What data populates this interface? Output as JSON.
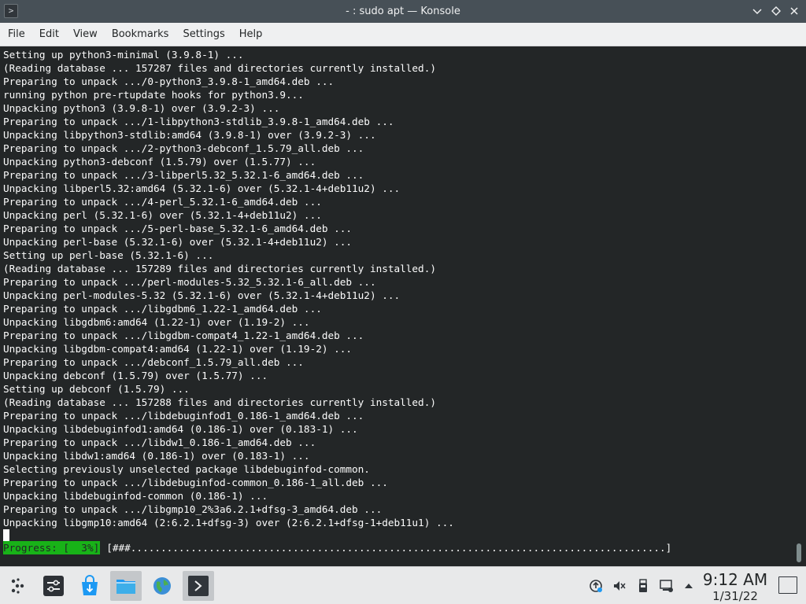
{
  "window": {
    "title": "- : sudo apt — Konsole",
    "app_icon": "terminal-icon"
  },
  "menu": {
    "items": [
      {
        "label": "File"
      },
      {
        "label": "Edit"
      },
      {
        "label": "View"
      },
      {
        "label": "Bookmarks"
      },
      {
        "label": "Settings"
      },
      {
        "label": "Help"
      }
    ]
  },
  "terminal": {
    "lines": [
      "Setting up python3-minimal (3.9.8-1) ...",
      "(Reading database ... 157287 files and directories currently installed.)",
      "Preparing to unpack .../0-python3_3.9.8-1_amd64.deb ...",
      "running python pre-rtupdate hooks for python3.9...",
      "Unpacking python3 (3.9.8-1) over (3.9.2-3) ...",
      "Preparing to unpack .../1-libpython3-stdlib_3.9.8-1_amd64.deb ...",
      "Unpacking libpython3-stdlib:amd64 (3.9.8-1) over (3.9.2-3) ...",
      "Preparing to unpack .../2-python3-debconf_1.5.79_all.deb ...",
      "Unpacking python3-debconf (1.5.79) over (1.5.77) ...",
      "Preparing to unpack .../3-libperl5.32_5.32.1-6_amd64.deb ...",
      "Unpacking libperl5.32:amd64 (5.32.1-6) over (5.32.1-4+deb11u2) ...",
      "Preparing to unpack .../4-perl_5.32.1-6_amd64.deb ...",
      "Unpacking perl (5.32.1-6) over (5.32.1-4+deb11u2) ...",
      "Preparing to unpack .../5-perl-base_5.32.1-6_amd64.deb ...",
      "Unpacking perl-base (5.32.1-6) over (5.32.1-4+deb11u2) ...",
      "Setting up perl-base (5.32.1-6) ...",
      "(Reading database ... 157289 files and directories currently installed.)",
      "Preparing to unpack .../perl-modules-5.32_5.32.1-6_all.deb ...",
      "Unpacking perl-modules-5.32 (5.32.1-6) over (5.32.1-4+deb11u2) ...",
      "Preparing to unpack .../libgdbm6_1.22-1_amd64.deb ...",
      "Unpacking libgdbm6:amd64 (1.22-1) over (1.19-2) ...",
      "Preparing to unpack .../libgdbm-compat4_1.22-1_amd64.deb ...",
      "Unpacking libgdbm-compat4:amd64 (1.22-1) over (1.19-2) ...",
      "Preparing to unpack .../debconf_1.5.79_all.deb ...",
      "Unpacking debconf (1.5.79) over (1.5.77) ...",
      "Setting up debconf (1.5.79) ...",
      "(Reading database ... 157288 files and directories currently installed.)",
      "Preparing to unpack .../libdebuginfod1_0.186-1_amd64.deb ...",
      "Unpacking libdebuginfod1:amd64 (0.186-1) over (0.183-1) ...",
      "Preparing to unpack .../libdw1_0.186-1_amd64.deb ...",
      "Unpacking libdw1:amd64 (0.186-1) over (0.183-1) ...",
      "Selecting previously unselected package libdebuginfod-common.",
      "Preparing to unpack .../libdebuginfod-common_0.186-1_all.deb ...",
      "Unpacking libdebuginfod-common (0.186-1) ...",
      "Preparing to unpack .../libgmp10_2%3a6.2.1+dfsg-3_amd64.deb ...",
      "Unpacking libgmp10:amd64 (2:6.2.1+dfsg-3) over (2:6.2.1+dfsg-1+deb11u1) ..."
    ],
    "progress_label": "Progress: [  3%]",
    "progress_bar": "[###.........................................................................................]",
    "progress_percent": 3
  },
  "taskbar": {
    "launcher": {
      "icon": "app-launcher-icon"
    },
    "pinned": [
      {
        "icon": "system-settings-icon",
        "active": false
      },
      {
        "icon": "discover-store-icon",
        "active": false
      },
      {
        "icon": "file-manager-icon",
        "active": true
      },
      {
        "icon": "web-browser-icon",
        "active": false
      },
      {
        "icon": "konsole-terminal-icon",
        "active": true
      }
    ],
    "tray": [
      {
        "icon": "update-notifier-icon"
      },
      {
        "icon": "volume-muted-icon"
      },
      {
        "icon": "removable-device-icon"
      },
      {
        "icon": "network-wired-icon"
      },
      {
        "icon": "expand-tray-arrow-icon"
      }
    ],
    "clock": {
      "time": "9:12 AM",
      "date": "1/31/22"
    }
  },
  "colors": {
    "terminal_bg": "#232627",
    "terminal_fg": "#fcfcfc",
    "progress_green": "#18b218",
    "titlebar_bg": "#475057"
  }
}
